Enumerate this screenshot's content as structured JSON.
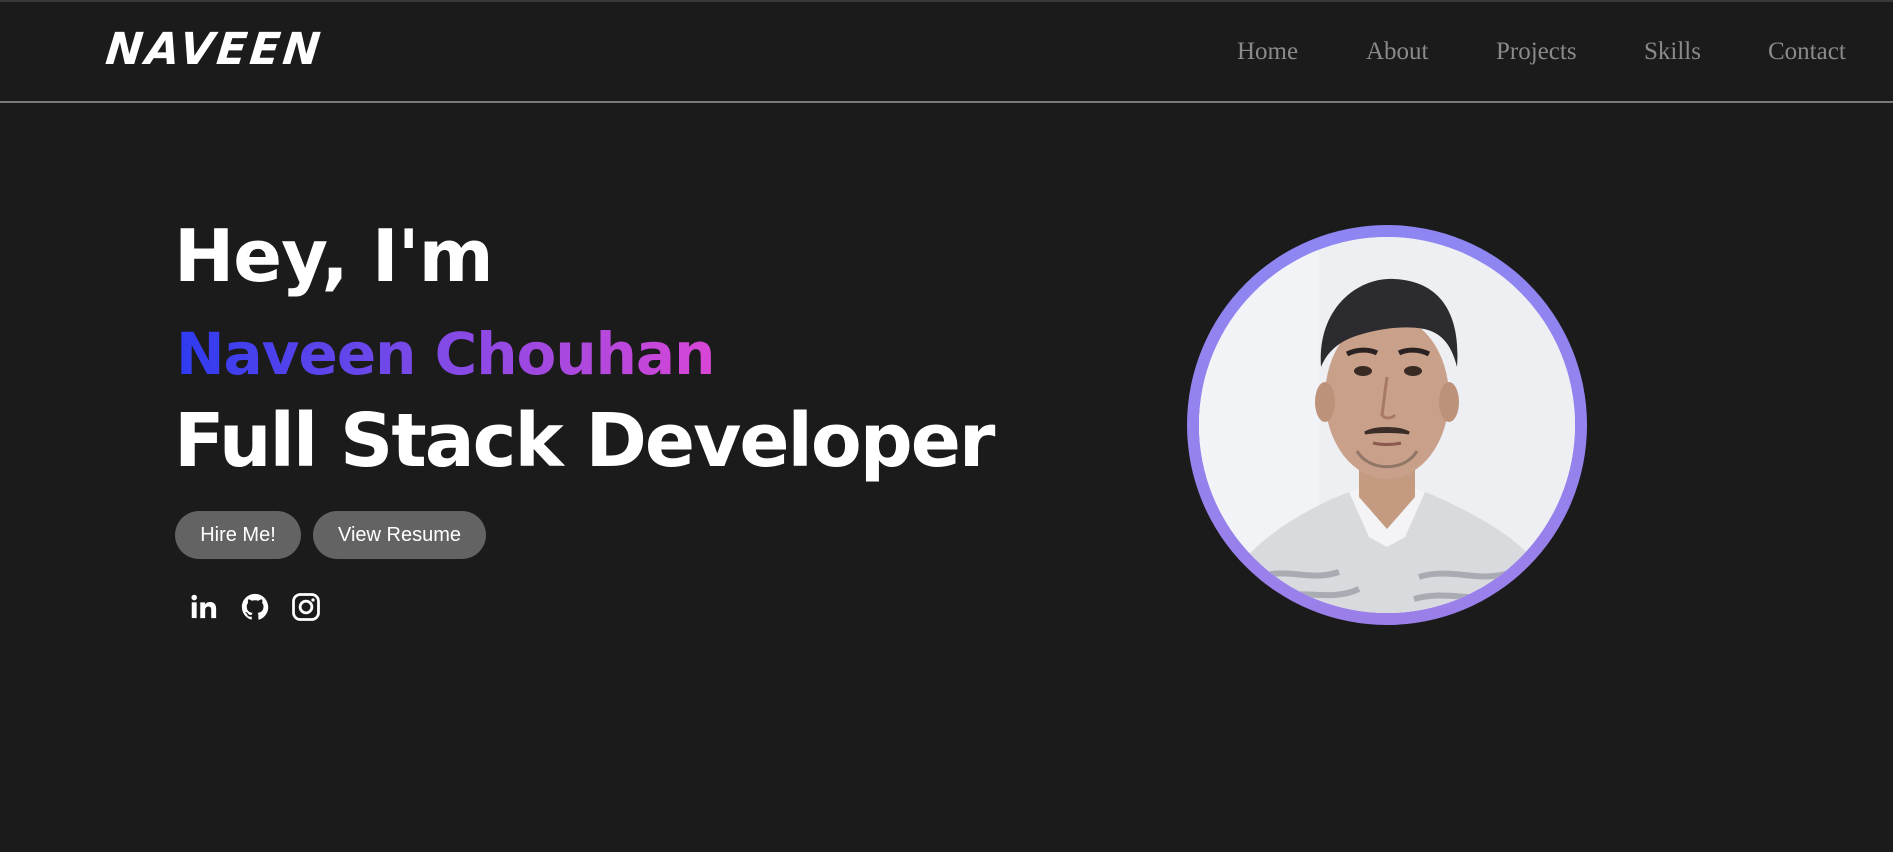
{
  "header": {
    "logo": "NAVEEN",
    "nav": [
      {
        "label": "Home"
      },
      {
        "label": "About"
      },
      {
        "label": "Projects"
      },
      {
        "label": "Skills"
      },
      {
        "label": "Contact"
      }
    ]
  },
  "hero": {
    "greeting": "Hey, I'm",
    "name": "Naveen Chouhan",
    "role": "Full Stack Developer",
    "buttons": {
      "hire": "Hire Me!",
      "resume": "View Resume"
    },
    "socials": [
      {
        "icon": "linkedin-icon"
      },
      {
        "icon": "github-icon"
      },
      {
        "icon": "instagram-icon"
      }
    ],
    "photo": {
      "icon": "profile-photo"
    }
  },
  "colors": {
    "background": "#1b1b1c",
    "nav_text": "#8a8a8a",
    "button_bg": "#636363",
    "gradient_start": "#2e3bf0",
    "gradient_end": "#d946d6",
    "ring": "#8d86f2"
  }
}
